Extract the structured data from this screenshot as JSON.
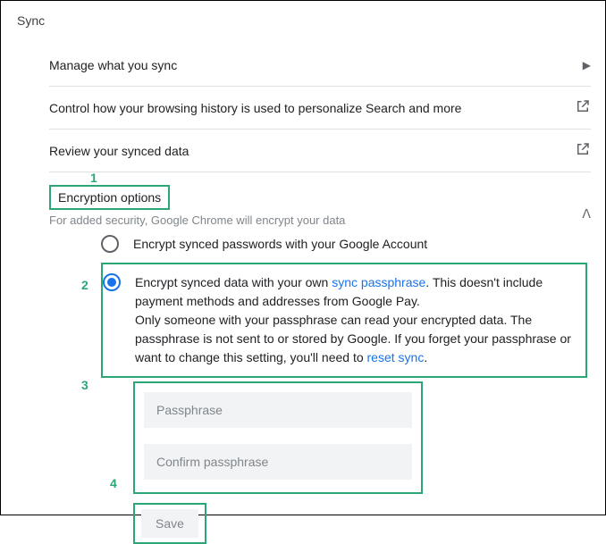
{
  "page_title": "Sync",
  "rows": {
    "manage": "Manage what you sync",
    "personalize": "Control how your browsing history is used to personalize Search and more",
    "review": "Review your synced data"
  },
  "encryption": {
    "title": "Encryption options",
    "subtitle": "For added security, Google Chrome will encrypt your data",
    "option1": "Encrypt synced passwords with your Google Account",
    "option2_pre": "Encrypt synced data with your own ",
    "option2_link1": "sync passphrase",
    "option2_mid": ". This doesn't include payment methods and addresses from Google Pay.",
    "option2_body": "Only someone with your passphrase can read your encrypted data. The passphrase is not sent to or stored by Google. If you forget your passphrase or want to change this setting, you'll need to ",
    "option2_link2": "reset sync",
    "option2_post": "."
  },
  "fields": {
    "passphrase": "Passphrase",
    "confirm": "Confirm passphrase"
  },
  "buttons": {
    "save": "Save"
  },
  "annotations": {
    "n1": "1",
    "n2": "2",
    "n3": "3",
    "n4": "4"
  }
}
